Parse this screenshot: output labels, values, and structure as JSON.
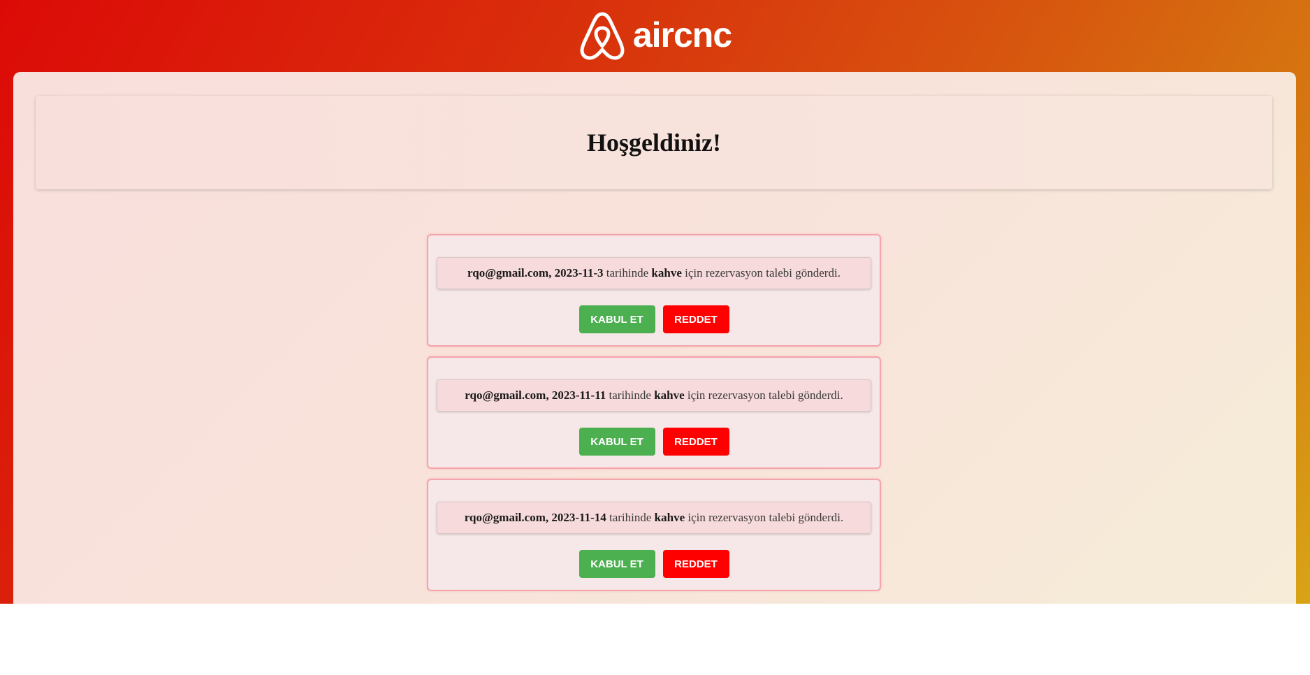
{
  "header": {
    "logo_text": "aircnc"
  },
  "welcome": {
    "title": "Hoşgeldiniz!"
  },
  "requests": [
    {
      "email": "rqo@gmail.com,",
      "date": "2023-11-3",
      "date_suffix": "tarihinde",
      "item": "kahve",
      "message": "için rezervasyon talebi gönderdi.",
      "accept_label": "KABUL ET",
      "reject_label": "REDDET"
    },
    {
      "email": "rqo@gmail.com,",
      "date": "2023-11-11",
      "date_suffix": "tarihinde",
      "item": "kahve",
      "message": "için rezervasyon talebi gönderdi.",
      "accept_label": "KABUL ET",
      "reject_label": "REDDET"
    },
    {
      "email": "rqo@gmail.com,",
      "date": "2023-11-14",
      "date_suffix": "tarihinde",
      "item": "kahve",
      "message": "için rezervasyon talebi gönderdi.",
      "accept_label": "KABUL ET",
      "reject_label": "REDDET"
    }
  ],
  "colors": {
    "accept": "#4caf50",
    "reject": "#ff0000",
    "brand_gradient_start": "#dc0a07",
    "brand_gradient_end": "#d8a416"
  },
  "icons": {
    "logo": "airbnb-belo-icon"
  }
}
